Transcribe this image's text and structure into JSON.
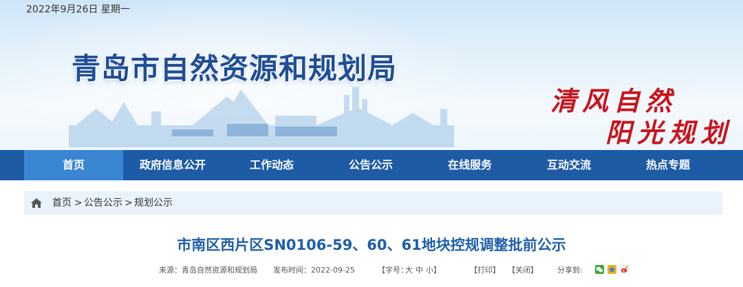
{
  "header": {
    "date": "2022年9月26日 星期一",
    "site_title": "青岛市自然资源和规划局",
    "slogan_line1": "清风自然",
    "slogan_line2": "阳光规划"
  },
  "nav": {
    "items": [
      "首页",
      "政府信息公开",
      "工作动态",
      "公告公示",
      "在线服务",
      "互动交流",
      "热点专题"
    ],
    "active_index": 0
  },
  "breadcrumb": {
    "home": "首页",
    "sep1": ">",
    "level1": "公告公示",
    "sep2": ">",
    "level2": "规划公示"
  },
  "article": {
    "title": "市南区西片区SN0106-59、60、61地块控规调整批前公示",
    "source": "来源：青岛自然资源和规划局",
    "publish_time": "发布时间：2022-09-25",
    "font_size_prefix": "【字号：",
    "font_large": "大",
    "font_medium": "中",
    "font_small": "小",
    "font_size_suffix": "】",
    "print": "【打印】",
    "close": "【关闭】",
    "share_label": "分享到:"
  },
  "colors": {
    "nav_bg": "#1d5ba5",
    "nav_active": "#3a86d2",
    "title_blue": "#1f5ea8",
    "slogan_red": "#c8141c",
    "crumb_bg": "#e9f3fb"
  },
  "icons": {
    "breadcrumb": "home-icon",
    "share": [
      "wechat-icon",
      "qzone-icon",
      "weibo-icon"
    ]
  }
}
